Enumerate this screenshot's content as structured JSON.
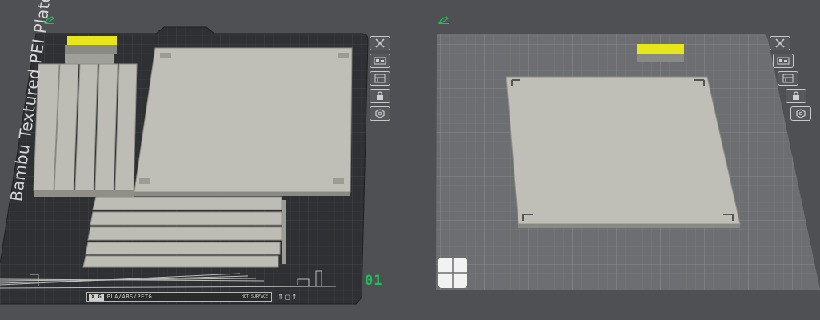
{
  "plates": [
    {
      "id": "plate-1",
      "plate_name": "Bambu Textured PEI Plate",
      "plate_number": "01",
      "material_tag": "X G",
      "material_label": "PLA/ABS/PETG",
      "hot_surface_label": "HOT SURFACE",
      "bottom_icons": "⇑◻⇑"
    },
    {
      "id": "plate-2"
    }
  ],
  "plate_tools": [
    {
      "name": "close-plate-button",
      "icon": "close-icon"
    },
    {
      "name": "arrange-button",
      "icon": "arrange-icon"
    },
    {
      "name": "auto-orient-button",
      "icon": "orient-icon"
    },
    {
      "name": "lock-plate-button",
      "icon": "lock-icon"
    },
    {
      "name": "plate-settings-button",
      "icon": "settings-icon"
    }
  ],
  "colors": {
    "background": "#4f5053",
    "plate_dark": "#2f3033",
    "plate_light": "#6d6e71",
    "model_gray": "#bdbdb5",
    "model_yellow": "#e6e61a",
    "accent_green": "#1fbf57"
  }
}
